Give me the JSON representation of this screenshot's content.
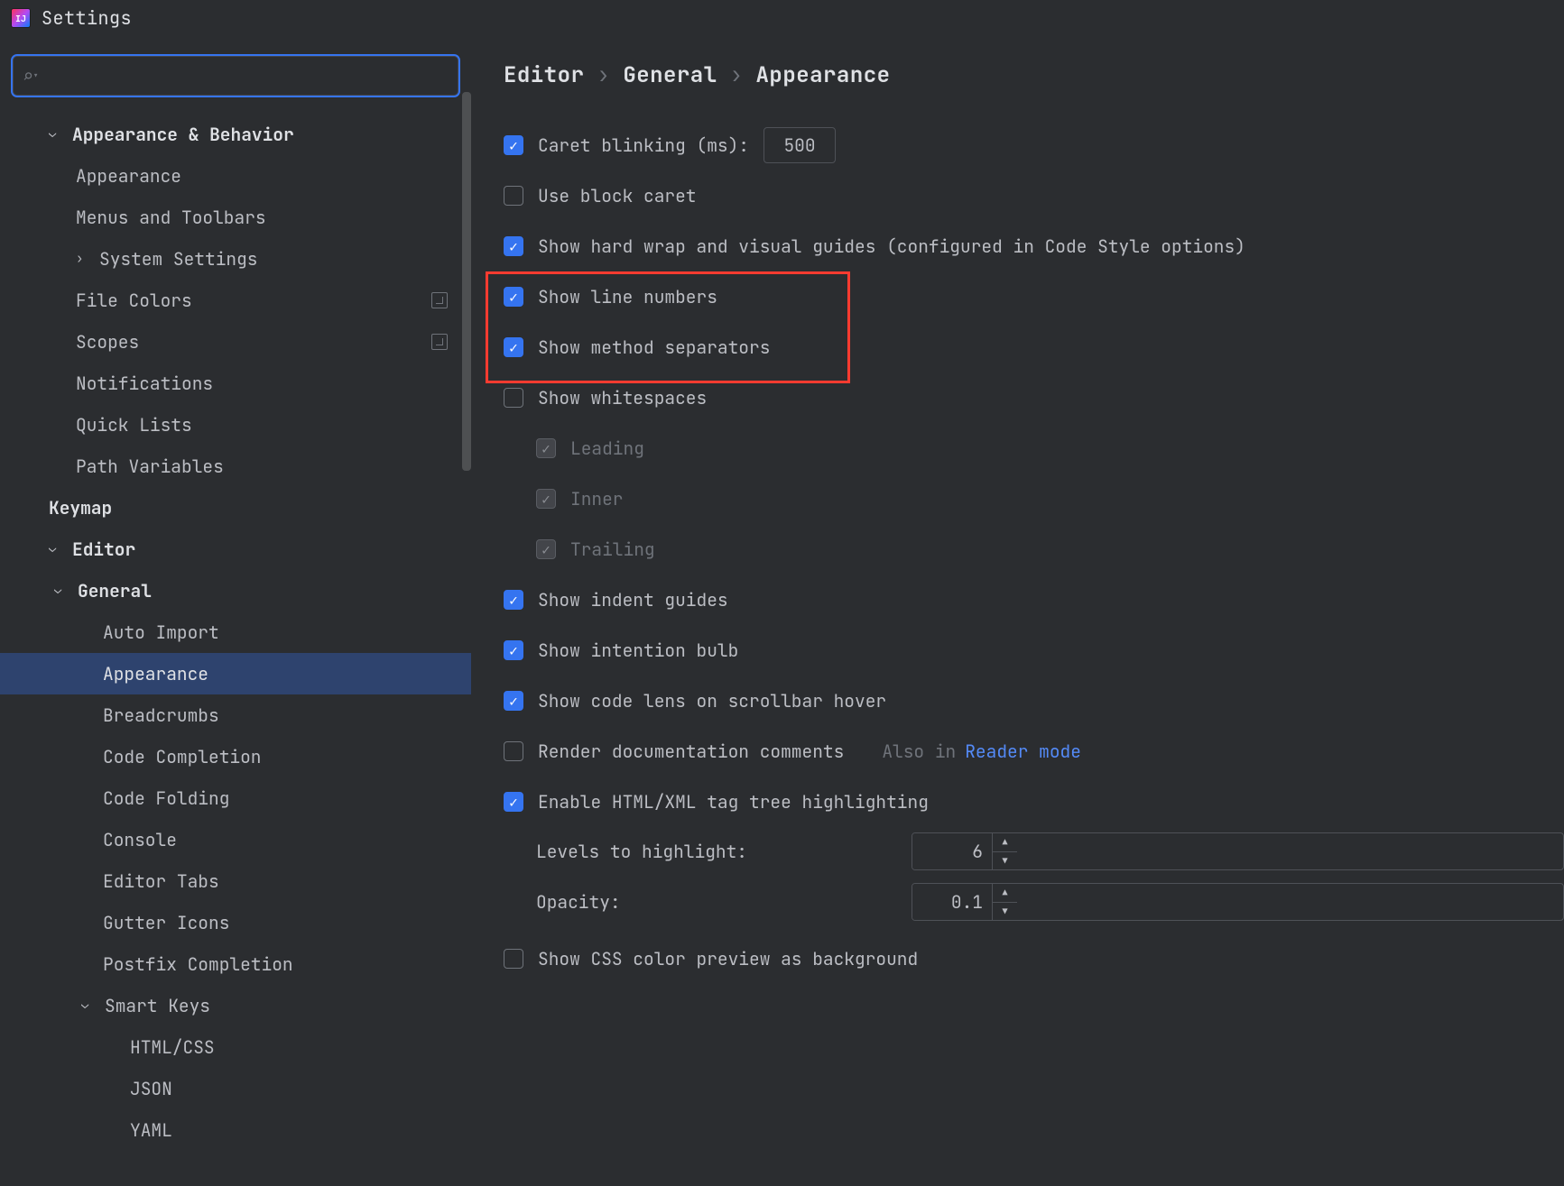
{
  "title": "Settings",
  "breadcrumb": {
    "a": "Editor",
    "b": "General",
    "c": "Appearance",
    "sep": "›"
  },
  "sidebar": {
    "search_placeholder": "",
    "items": {
      "appearance_behavior": "Appearance & Behavior",
      "appearance": "Appearance",
      "menus_toolbars": "Menus and Toolbars",
      "system_settings": "System Settings",
      "file_colors": "File Colors",
      "scopes": "Scopes",
      "notifications": "Notifications",
      "quick_lists": "Quick Lists",
      "path_variables": "Path Variables",
      "keymap": "Keymap",
      "editor": "Editor",
      "general": "General",
      "auto_import": "Auto Import",
      "appearance2": "Appearance",
      "breadcrumbs": "Breadcrumbs",
      "code_completion": "Code Completion",
      "code_folding": "Code Folding",
      "console": "Console",
      "editor_tabs": "Editor Tabs",
      "gutter_icons": "Gutter Icons",
      "postfix_completion": "Postfix Completion",
      "smart_keys": "Smart Keys",
      "html_css": "HTML/CSS",
      "json": "JSON",
      "yaml": "YAML"
    }
  },
  "settings": {
    "caret_blinking_label": "Caret blinking (ms):",
    "caret_blinking_value": "500",
    "use_block_caret": "Use block caret",
    "show_hard_wrap": "Show hard wrap and visual guides (configured in Code Style options)",
    "show_line_numbers": "Show line numbers",
    "show_method_separators": "Show method separators",
    "show_whitespaces": "Show whitespaces",
    "leading": "Leading",
    "inner": "Inner",
    "trailing": "Trailing",
    "show_indent_guides": "Show indent guides",
    "show_intention_bulb": "Show intention bulb",
    "show_code_lens": "Show code lens on scrollbar hover",
    "render_doc_comments": "Render documentation comments",
    "also_in": "Also in",
    "reader_mode": "Reader mode",
    "enable_html_tree": "Enable HTML/XML tag tree highlighting",
    "levels_label": "Levels to highlight:",
    "levels_value": "6",
    "opacity_label": "Opacity:",
    "opacity_value": "0.1",
    "show_css_preview": "Show CSS color preview as background"
  }
}
